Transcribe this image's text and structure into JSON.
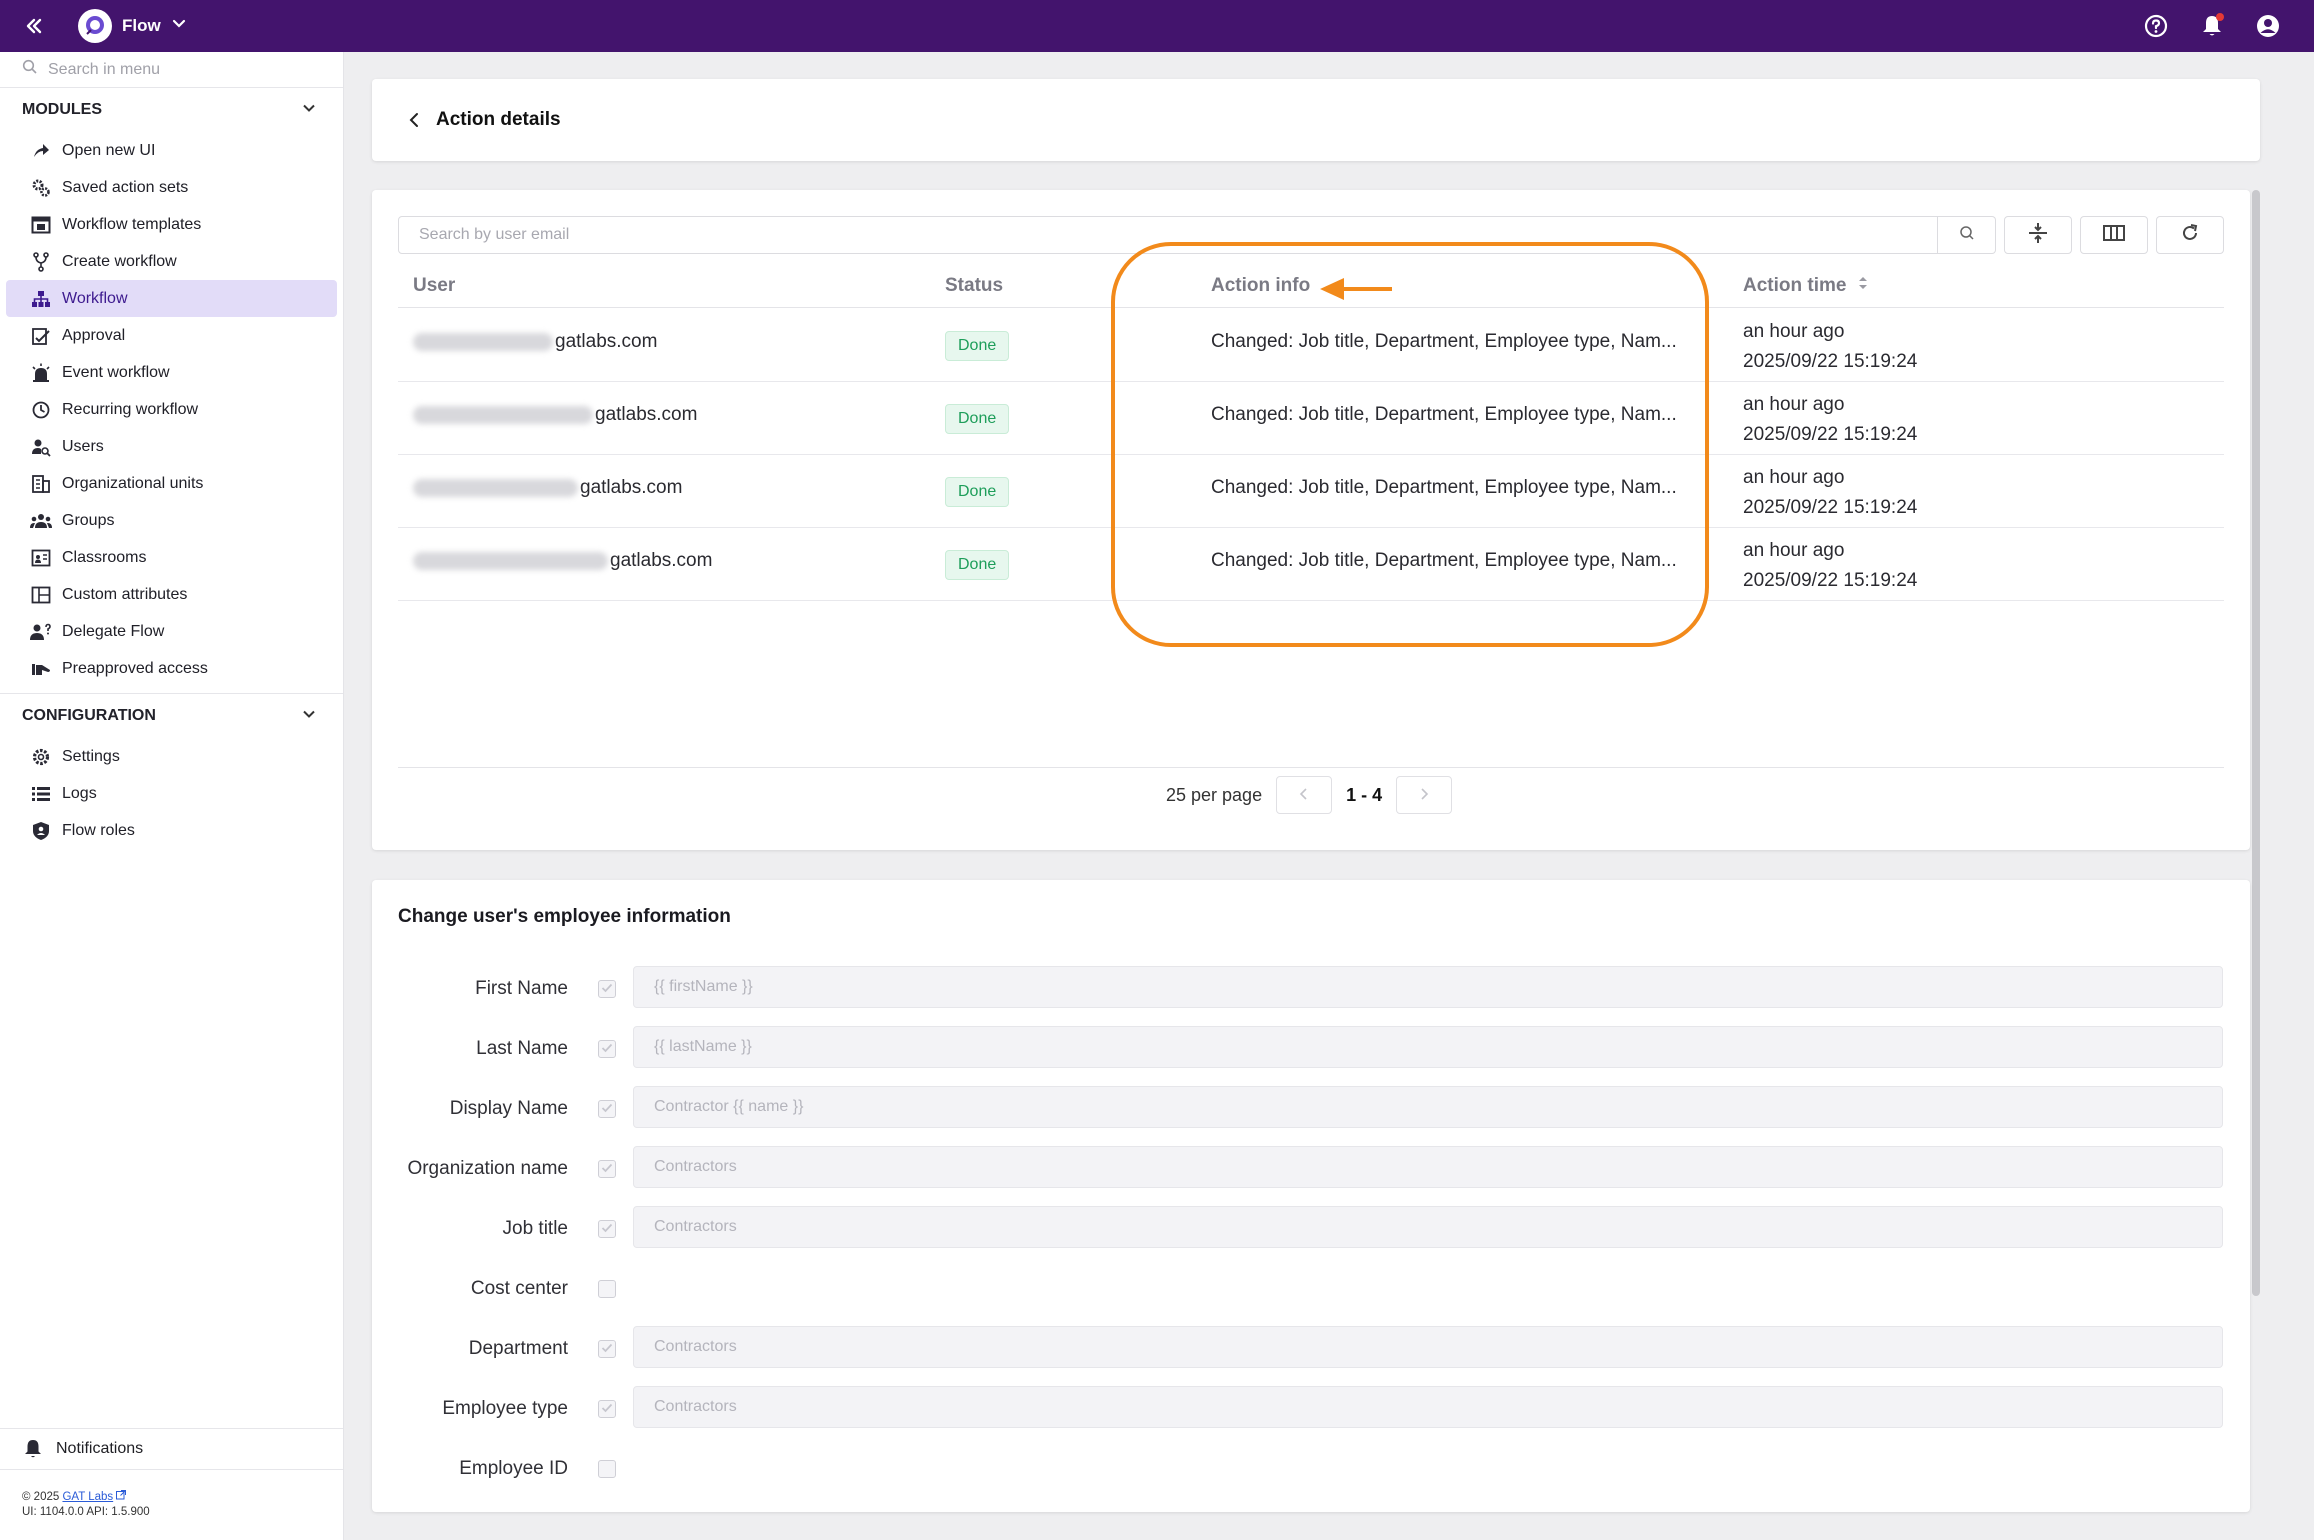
{
  "app": {
    "name": "Flow"
  },
  "sidebar": {
    "search_placeholder": "Search in menu",
    "modules_heading": "MODULES",
    "modules": [
      {
        "label": "Open new UI",
        "icon": "share-arrow-icon"
      },
      {
        "label": "Saved action sets",
        "icon": "gears-icon"
      },
      {
        "label": "Workflow templates",
        "icon": "template-icon"
      },
      {
        "label": "Create workflow",
        "icon": "fork-icon"
      },
      {
        "label": "Workflow",
        "icon": "hierarchy-icon",
        "active": true
      },
      {
        "label": "Approval",
        "icon": "approval-icon"
      },
      {
        "label": "Event workflow",
        "icon": "alarm-light-icon"
      },
      {
        "label": "Recurring workflow",
        "icon": "history-icon"
      },
      {
        "label": "Users",
        "icon": "user-search-icon"
      },
      {
        "label": "Organizational units",
        "icon": "building-icon"
      },
      {
        "label": "Groups",
        "icon": "groups-icon"
      },
      {
        "label": "Classrooms",
        "icon": "classroom-icon"
      },
      {
        "label": "Custom attributes",
        "icon": "attributes-icon"
      },
      {
        "label": "Delegate Flow",
        "icon": "delegate-icon"
      },
      {
        "label": "Preapproved access",
        "icon": "preapproved-icon"
      }
    ],
    "config_heading": "CONFIGURATION",
    "config": [
      {
        "label": "Settings",
        "icon": "gear-icon"
      },
      {
        "label": "Logs",
        "icon": "list-icon"
      },
      {
        "label": "Flow roles",
        "icon": "shield-icon"
      }
    ],
    "notifications_label": "Notifications",
    "footer": {
      "copyright_prefix": "© 2025 ",
      "company": "GAT Labs",
      "versions": "UI: 1104.0.0 API: 1.5.900"
    }
  },
  "header": {
    "title": "Action details"
  },
  "table": {
    "search_placeholder": "Search by user email",
    "columns": {
      "user": "User",
      "status": "Status",
      "action_info": "Action info",
      "action_time": "Action time"
    },
    "rows": [
      {
        "user_domain": "gatlabs.com",
        "status": "Done",
        "info": "Changed: Job title, Department, Employee type, Nam...",
        "relative": "an hour ago",
        "timestamp": "2025/09/22 15:19:24"
      },
      {
        "user_domain": "gatlabs.com",
        "status": "Done",
        "info": "Changed: Job title, Department, Employee type, Nam...",
        "relative": "an hour ago",
        "timestamp": "2025/09/22 15:19:24"
      },
      {
        "user_domain": "gatlabs.com",
        "status": "Done",
        "info": "Changed: Job title, Department, Employee type, Nam...",
        "relative": "an hour ago",
        "timestamp": "2025/09/22 15:19:24"
      },
      {
        "user_domain": "gatlabs.com",
        "status": "Done",
        "info": "Changed: Job title, Department, Employee type, Nam...",
        "relative": "an hour ago",
        "timestamp": "2025/09/22 15:19:24"
      }
    ],
    "pagination": {
      "per_page": "25 per page",
      "range": "1 - 4"
    }
  },
  "annotation": {
    "color": "#f28a1b"
  },
  "form": {
    "title": "Change user's employee information",
    "fields": [
      {
        "label": "First Name",
        "checked": true,
        "placeholder": "{{ firstName }}"
      },
      {
        "label": "Last Name",
        "checked": true,
        "placeholder": "{{ lastName }}"
      },
      {
        "label": "Display Name",
        "checked": true,
        "placeholder": "Contractor {{ name }}"
      },
      {
        "label": "Organization name",
        "checked": true,
        "placeholder": "Contractors"
      },
      {
        "label": "Job title",
        "checked": true,
        "placeholder": "Contractors"
      },
      {
        "label": "Cost center",
        "checked": false,
        "placeholder": null
      },
      {
        "label": "Department",
        "checked": true,
        "placeholder": "Contractors"
      },
      {
        "label": "Employee type",
        "checked": true,
        "placeholder": "Contractors"
      },
      {
        "label": "Employee ID",
        "checked": false,
        "placeholder": null
      }
    ]
  },
  "colors": {
    "topbar": "#43146d",
    "active_menu_bg": "#e2dcf8",
    "done_badge": "#1e9e5a"
  }
}
